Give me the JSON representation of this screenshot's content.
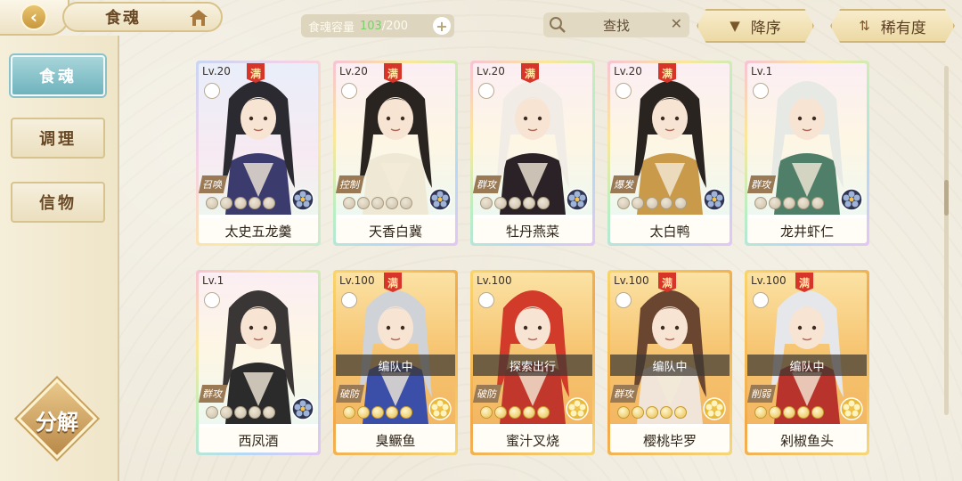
{
  "header": {
    "title": "食魂",
    "capacity_label": "食魂容量",
    "capacity_current": "103",
    "capacity_max": "/200",
    "search_placeholder": "查找",
    "sort_desc_label": "降序",
    "sort_rarity_label": "稀有度"
  },
  "sidebar": {
    "items": [
      {
        "label": "食魂",
        "active": true
      },
      {
        "label": "调理",
        "active": false
      },
      {
        "label": "信物",
        "active": false
      }
    ],
    "decompose_label": "分解"
  },
  "cards": [
    {
      "level": "Lv.20",
      "full": "满",
      "role": "召唤",
      "name": "太史五龙羹",
      "stars_lit": 0,
      "status": "",
      "rarity": "blue",
      "hair": "#2a2a30",
      "robe": "#3b3b6e",
      "flower": "#2f3550"
    },
    {
      "level": "Lv.20",
      "full": "满",
      "role": "控制",
      "name": "天香白冀",
      "stars_lit": 0,
      "status": "",
      "rarity": "rainbow",
      "hair": "#2a2420",
      "robe": "#efe8d4",
      "flower": "#2f3550"
    },
    {
      "level": "Lv.20",
      "full": "满",
      "role": "群攻",
      "name": "牡丹燕菜",
      "stars_lit": 0,
      "status": "",
      "rarity": "rainbow",
      "hair": "#f1ede6",
      "robe": "#2a2226",
      "flower": "#2f3550"
    },
    {
      "level": "Lv.20",
      "full": "满",
      "role": "爆发",
      "name": "太白鸭",
      "stars_lit": 0,
      "status": "",
      "rarity": "rainbow",
      "hair": "#2a2420",
      "robe": "#c89a4a",
      "flower": "#2f3550"
    },
    {
      "level": "Lv.1",
      "full": "",
      "role": "群攻",
      "name": "龙井虾仁",
      "stars_lit": 0,
      "status": "",
      "rarity": "rainbow",
      "hair": "#e7e9e4",
      "robe": "#4f7f68",
      "flower": "#2f3550"
    },
    {
      "level": "Lv.1",
      "full": "",
      "role": "群攻",
      "name": "西凤酒",
      "stars_lit": 0,
      "status": "",
      "rarity": "rainbow",
      "hair": "#3a3636",
      "robe": "#2b2b2b",
      "flower": "#2f3550"
    },
    {
      "level": "Lv.100",
      "full": "满",
      "role": "破防",
      "name": "臭鳜鱼",
      "stars_lit": 5,
      "status": "编队中",
      "rarity": "gold",
      "hair": "#cfd2d6",
      "robe": "#3b4fa8",
      "flower": "#e9b93a"
    },
    {
      "level": "Lv.100",
      "full": "",
      "role": "破防",
      "name": "蜜汁叉烧",
      "stars_lit": 5,
      "status": "探索出行",
      "rarity": "gold",
      "hair": "#d23a2a",
      "robe": "#c2372b",
      "flower": "#e9b93a"
    },
    {
      "level": "Lv.100",
      "full": "满",
      "role": "群攻",
      "name": "樱桃毕罗",
      "stars_lit": 5,
      "status": "编队中",
      "rarity": "gold",
      "hair": "#6a4530",
      "robe": "#f1e4d8",
      "flower": "#e9b93a"
    },
    {
      "level": "Lv.100",
      "full": "满",
      "role": "削弱",
      "name": "剁椒鱼头",
      "stars_lit": 5,
      "status": "编队中",
      "rarity": "gold",
      "hair": "#e5e7ea",
      "robe": "#b8332c",
      "flower": "#e9b93a"
    }
  ]
}
